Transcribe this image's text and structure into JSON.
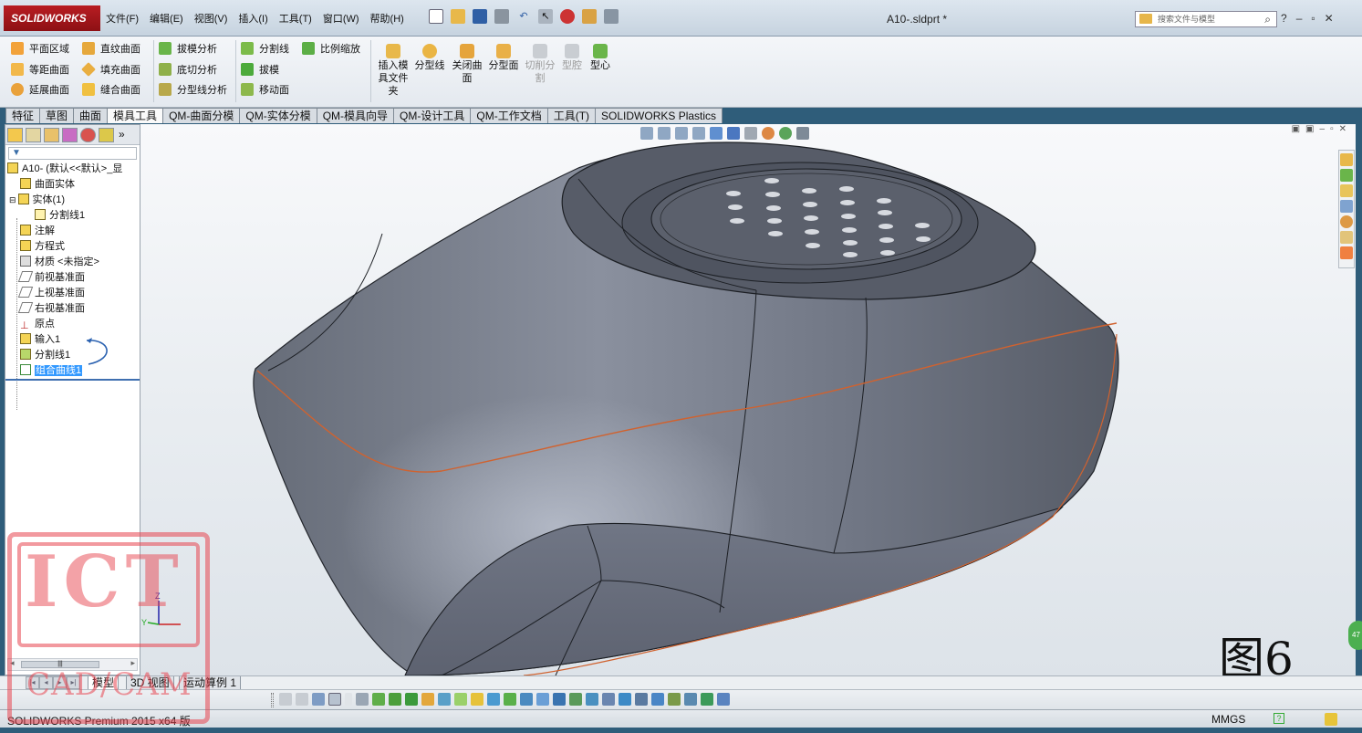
{
  "app": {
    "logo": "SOLIDWORKS",
    "menus": [
      "文件(F)",
      "编辑(E)",
      "视图(V)",
      "插入(I)",
      "工具(T)",
      "窗口(W)",
      "帮助(H)"
    ],
    "document_title": "A10-.sldprt *",
    "search_placeholder": "搜索文件与模型"
  },
  "ribbon": {
    "col1": [
      "平面区域",
      "等距曲面",
      "延展曲面"
    ],
    "col2": [
      "直纹曲面",
      "填充曲面",
      "缝合曲面"
    ],
    "col3": [
      "拔模分析",
      "底切分析",
      "分型线分析"
    ],
    "col4": [
      "分割线",
      "拔模",
      "移动面"
    ],
    "col5": [
      "比例缩放"
    ],
    "big": {
      "insert_mold_folder": "插入模具文件夹",
      "parting_lines": "分型线",
      "shut_off_surfaces": "关闭曲面",
      "parting_surface": "分型面",
      "tooling_split": "切削分割",
      "cavity": "型腔",
      "core": "型心"
    }
  },
  "tabs": [
    "特征",
    "草图",
    "曲面",
    "模具工具",
    "QM-曲面分模",
    "QM-实体分模",
    "QM-模具向导",
    "QM-设计工具",
    "QM-工作文档",
    "工具(T)",
    "SOLIDWORKS Plastics"
  ],
  "tree": {
    "root": "A10- (默认<<默认>_显",
    "items": [
      "曲面实体",
      "实体(1)",
      "分割线1",
      "注解",
      "方程式",
      "材质 <未指定>",
      "前视基准面",
      "上视基准面",
      "右视基准面",
      "原点",
      "输入1",
      "分割线1",
      "组合曲线1"
    ]
  },
  "viewport": {
    "figure_label": "图6",
    "triad": {
      "z": "Z",
      "y": "Y"
    },
    "side_tab": "47"
  },
  "bottom_tabs": [
    "模型",
    "3D 视图",
    "运动算例 1"
  ],
  "status": {
    "left": "SOLIDWORKS Premium 2015 x64 版",
    "units": "MMGS"
  },
  "watermark": {
    "top": "ICT",
    "bottom": "CAD/CAM"
  },
  "colors": {
    "accent": "#3399ff",
    "part": "#6c7280",
    "parting_line": "#d0622f"
  }
}
